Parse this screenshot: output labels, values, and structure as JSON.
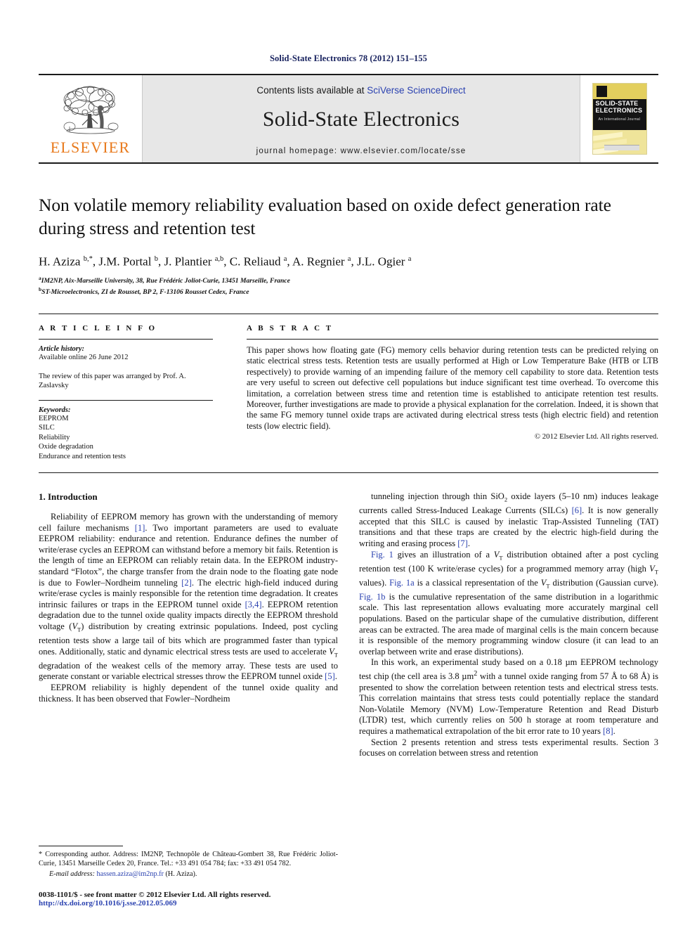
{
  "running_head": "Solid-State Electronics 78 (2012) 151–155",
  "masthead": {
    "contents_prefix": "Contents lists available at ",
    "sciencedirect_link": "SciVerse ScienceDirect",
    "journal_name": "Solid-State Electronics",
    "homepage": "journal homepage: www.elsevier.com/locate/sse",
    "publisher_name": "ELSEVIER",
    "cover": {
      "title_line1": "SOLID-STATE",
      "title_line2": "ELECTRONICS",
      "subtitle": "An International Journal"
    }
  },
  "article": {
    "title": "Non volatile memory reliability evaluation based on oxide defect generation rate during stress and retention test",
    "authors_html": "H. Aziza <sup>b,</sup><sup>*</sup>, J.M. Portal <sup>b</sup>, J. Plantier <sup>a,b</sup>, C. Reliaud <sup>a</sup>, A. Regnier <sup>a</sup>, J.L. Ogier <sup>a</sup>",
    "affiliations": [
      "IM2NP, Aix-Marseille University, 38, Rue Frédéric Joliot-Curie, 13451 Marseille, France",
      "ST-Microelectronics, ZI de Rousset, BP 2, F-13106 Rousset Cedex, France"
    ],
    "affil_marks": [
      "a",
      "b"
    ]
  },
  "info": {
    "heading": "A R T I C L E  I N F O",
    "history_label": "Article history:",
    "history_value": "Available online 26 June 2012",
    "editor_note": "The review of this paper was arranged by Prof. A. Zaslavsky",
    "keywords_label": "Keywords:",
    "keywords": [
      "EEPROM",
      "SILC",
      "Reliability",
      "Oxide degradation",
      "Endurance and retention tests"
    ]
  },
  "abstract": {
    "heading": "A B S T R A C T",
    "text": "This paper shows how floating gate (FG) memory cells behavior during retention tests can be predicted relying on static electrical stress tests. Retention tests are usually performed at High or Low Temperature Bake (HTB or LTB respectively) to provide warning of an impending failure of the memory cell capability to store data. Retention tests are very useful to screen out defective cell populations but induce significant test time overhead. To overcome this limitation, a correlation between stress time and retention time is established to anticipate retention test results. Moreover, further investigations are made to provide a physical explanation for the correlation. Indeed, it is shown that the same FG memory tunnel oxide traps are activated during electrical stress tests (high electric field) and retention tests (low electric field).",
    "copyright": "© 2012 Elsevier Ltd. All rights reserved."
  },
  "body": {
    "section_title": "1. Introduction",
    "left_paragraphs": [
      "Reliability of EEPROM memory has grown with the understanding of memory cell failure mechanisms [1]. Two important parameters are used to evaluate EEPROM reliability: endurance and retention. Endurance defines the number of write/erase cycles an EEPROM can withstand before a memory bit fails. Retention is the length of time an EEPROM can reliably retain data. In the EEPROM industry-standard “Flotox”, the charge transfer from the drain node to the floating gate node is due to Fowler–Nordheim tunneling [2]. The electric high-field induced during write/erase cycles is mainly responsible for the retention time degradation. It creates intrinsic failures or traps in the EEPROM tunnel oxide [3,4]. EEPROM retention degradation due to the tunnel oxide quality impacts directly the EEPROM threshold voltage (VT) distribution by creating extrinsic populations. Indeed, post cycling retention tests show a large tail of bits which are programmed faster than typical ones. Additionally, static and dynamic electrical stress tests are used to accelerate VT degradation of the weakest cells of the memory array. These tests are used to generate constant or variable electrical stresses throw the EEPROM tunnel oxide [5].",
      "EEPROM reliability is highly dependent of the tunnel oxide quality and thickness. It has been observed that Fowler–Nordheim"
    ],
    "right_paragraphs": [
      "tunneling injection through thin SiO2 oxide layers (5–10 nm) induces leakage currents called Stress-Induced Leakage Currents (SILCs) [6]. It is now generally accepted that this SILC is caused by inelastic Trap-Assisted Tunneling (TAT) transitions and that these traps are created by the electric high-field during the writing and erasing process [7].",
      "Fig. 1 gives an illustration of a VT distribution obtained after a post cycling retention test (100 K write/erase cycles) for a programmed memory array (high VT values). Fig. 1a is a classical representation of the VT distribution (Gaussian curve). Fig. 1b is the cumulative representation of the same distribution in a logarithmic scale. This last representation allows evaluating more accurately marginal cell populations. Based on the particular shape of the cumulative distribution, different areas can be extracted. The area made of marginal cells is the main concern because it is responsible of the memory programming window closure (it can lead to an overlap between write and erase distributions).",
      "In this work, an experimental study based on a 0.18 µm EEPROM technology test chip (the cell area is 3.8 µm2 with a tunnel oxide ranging from 57 Å to 68 Å) is presented to show the correlation between retention tests and electrical stress tests. This correlation maintains that stress tests could potentially replace the standard Non-Volatile Memory (NVM) Low-Temperature Retention and Read Disturb (LTDR) test, which currently relies on 500 h storage at room temperature and requires a mathematical extrapolation of the bit error rate to 10 years [8].",
      "Section 2 presents retention and stress tests experimental results. Section 3 focuses on correlation between stress and retention"
    ]
  },
  "footnote": {
    "marker": "*",
    "corresponding": "Corresponding author. Address: IM2NP, Technopôle de Château-Gombert 38, Rue Frédéric Joliot-Curie, 13451 Marseille Cedex 20, France. Tel.: +33 491 054 784; fax: +33 491 054 782.",
    "email_label": "E-mail address:",
    "email": "hassen.aziza@im2np.fr",
    "email_suffix": "(H. Aziza)."
  },
  "bottom": {
    "issn_line": "0038-1101/$ - see front matter © 2012 Elsevier Ltd. All rights reserved.",
    "doi": "http://dx.doi.org/10.1016/j.sse.2012.05.069"
  },
  "colors": {
    "link": "#2b42b0",
    "running_head": "#17215e",
    "elsevier_orange": "#e8791b",
    "masthead_bg": "#e7e7e7"
  }
}
